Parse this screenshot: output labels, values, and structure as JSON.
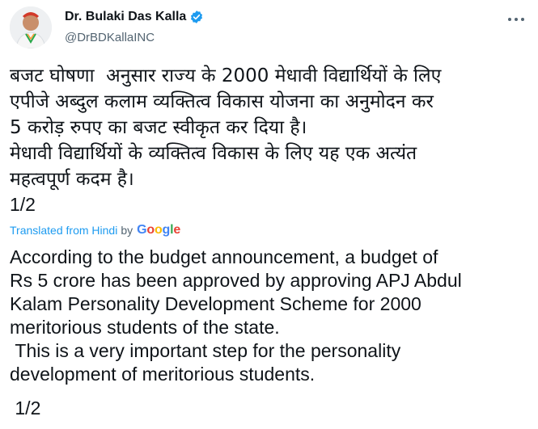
{
  "author": {
    "display_name": "Dr. Bulaki Das Kalla",
    "handle": "@DrBDKallaINC",
    "verified_icon": "verified-badge-icon",
    "avatar_icon": "profile-avatar"
  },
  "menu": {
    "icon": "more-options-icon"
  },
  "tweet": {
    "hindi_text": "बजट घोषणा  अनुसार राज्य के 2000 मेधावी विद्यार्थियों के लिए\nएपीजे अब्दुल कलाम व्यक्तित्व विकास योजना का अनुमोदन कर\n5 करोड़ रुपए का बजट स्वीकृत कर दिया है।\nमेधावी विद्यार्थियों के व्यक्तित्व विकास के लिए यह एक अत्यंत\nमहत्वपूर्ण कदम है।",
    "hindi_counter": "1/2",
    "translation_label": "Translated from Hindi",
    "translation_by": "by",
    "translation_provider": "Google",
    "english_text": "According to the budget announcement, a budget of\nRs 5 crore has been approved by approving APJ Abdul\nKalam Personality Development Scheme for 2000\nmeritorious students of the state.\n This is a very important step for the personality\ndevelopment of meritorious students.",
    "english_counter": " 1/2"
  },
  "colors": {
    "link": "#1d9bf0",
    "secondary_text": "#536471",
    "primary_text": "#0f1419",
    "verified": "#1d9bf0"
  }
}
